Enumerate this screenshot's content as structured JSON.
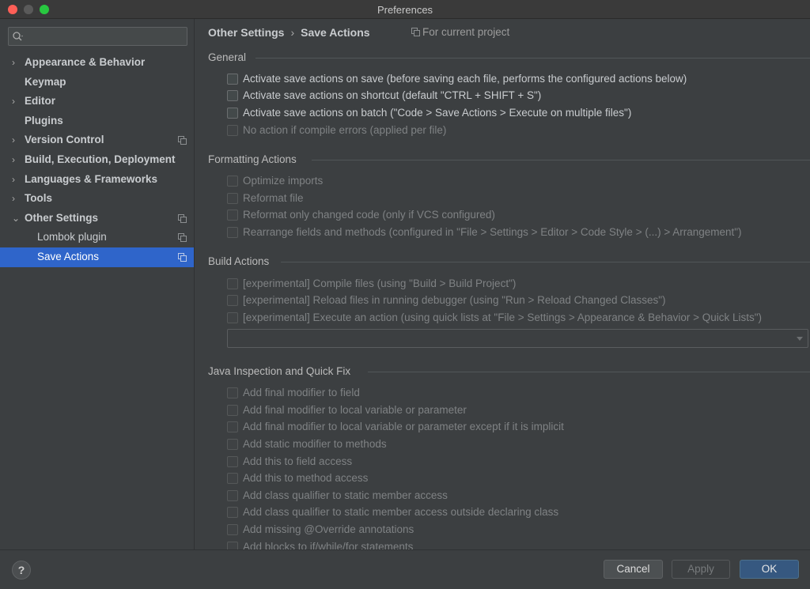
{
  "window": {
    "title": "Preferences"
  },
  "sidebar": {
    "search_placeholder": "",
    "items": [
      {
        "label": "Appearance & Behavior",
        "arrow": "›"
      },
      {
        "label": "Keymap",
        "arrow": ""
      },
      {
        "label": "Editor",
        "arrow": "›"
      },
      {
        "label": "Plugins",
        "arrow": ""
      },
      {
        "label": "Version Control",
        "arrow": "›"
      },
      {
        "label": "Build, Execution, Deployment",
        "arrow": "›"
      },
      {
        "label": "Languages & Frameworks",
        "arrow": "›"
      },
      {
        "label": "Tools",
        "arrow": "›"
      },
      {
        "label": "Other Settings",
        "arrow": "⌄"
      },
      {
        "label": "Lombok plugin",
        "arrow": ""
      },
      {
        "label": "Save Actions",
        "arrow": ""
      }
    ]
  },
  "main": {
    "breadcrumb": {
      "parent": "Other Settings",
      "separator": "›",
      "current": "Save Actions"
    },
    "scope": "For current project",
    "sections": {
      "general": {
        "title": "General",
        "options": [
          "Activate save actions on save (before saving each file, performs the configured actions below)",
          "Activate save actions on shortcut (default \"CTRL + SHIFT + S\")",
          "Activate save actions on batch (\"Code > Save Actions > Execute on multiple files\")",
          "No action if compile errors (applied per file)"
        ]
      },
      "formatting": {
        "title": "Formatting Actions",
        "options": [
          "Optimize imports",
          "Reformat file",
          "Reformat only changed code (only if VCS configured)",
          "Rearrange fields and methods (configured in \"File > Settings > Editor > Code Style > (...) > Arrangement\")"
        ]
      },
      "build": {
        "title": "Build Actions",
        "options": [
          "[experimental] Compile files (using \"Build > Build Project\")",
          "[experimental] Reload files in running debugger (using \"Run > Reload Changed Classes\")",
          "[experimental] Execute an action (using quick lists at \"File > Settings > Appearance & Behavior > Quick Lists\")"
        ],
        "combo_value": ""
      },
      "java": {
        "title": "Java Inspection and Quick Fix",
        "options": [
          "Add final modifier to field",
          "Add final modifier to local variable or parameter",
          "Add final modifier to local variable or parameter except if it is implicit",
          "Add static modifier to methods",
          "Add this to field access",
          "Add this to method access",
          "Add class qualifier to static member access",
          "Add class qualifier to static member access outside declaring class",
          "Add missing @Override annotations",
          "Add blocks to if/while/for statements"
        ]
      }
    }
  },
  "footer": {
    "help_label": "?",
    "cancel_label": "Cancel",
    "apply_label": "Apply",
    "ok_label": "OK"
  },
  "colors": {
    "selection": "#2f65ca",
    "ok_button": "#365880",
    "background": "#3c3f41"
  }
}
